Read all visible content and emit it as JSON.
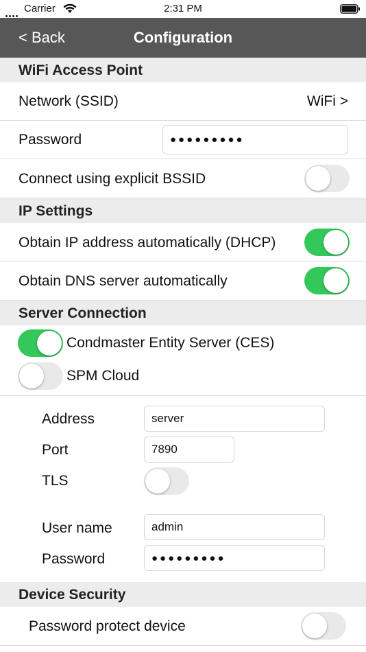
{
  "status_bar": {
    "carrier": "Carrier",
    "time": "2:31 PM"
  },
  "nav": {
    "back_label": "< Back",
    "title": "Configuration"
  },
  "wifi": {
    "section_title": "WiFi Access Point",
    "network_label": "Network (SSID)",
    "network_value": "WiFi >",
    "password_label": "Password",
    "password_value": "●●●●●●●●●",
    "bssid_label": "Connect using explicit BSSID",
    "bssid_enabled": false
  },
  "ip": {
    "section_title": "IP Settings",
    "dhcp_label": "Obtain IP address automatically (DHCP)",
    "dhcp_enabled": true,
    "dns_label": "Obtain DNS server automatically",
    "dns_enabled": true
  },
  "server": {
    "section_title": "Server Connection",
    "ces_label": "Condmaster Entity Server (CES)",
    "ces_enabled": true,
    "spm_label": "SPM Cloud",
    "spm_enabled": false,
    "address_label": "Address",
    "address_value": "server",
    "port_label": "Port",
    "port_value": "7890",
    "tls_label": "TLS",
    "tls_enabled": false,
    "username_label": "User name",
    "username_value": "admin",
    "password_label": "Password",
    "password_value": "●●●●●●●●●"
  },
  "device_security": {
    "section_title": "Device Security",
    "protect_label": "Password protect device",
    "protect_enabled": false
  },
  "colors": {
    "nav_background": "#575757",
    "toggle_on": "#34c759",
    "section_background": "#ececec"
  }
}
